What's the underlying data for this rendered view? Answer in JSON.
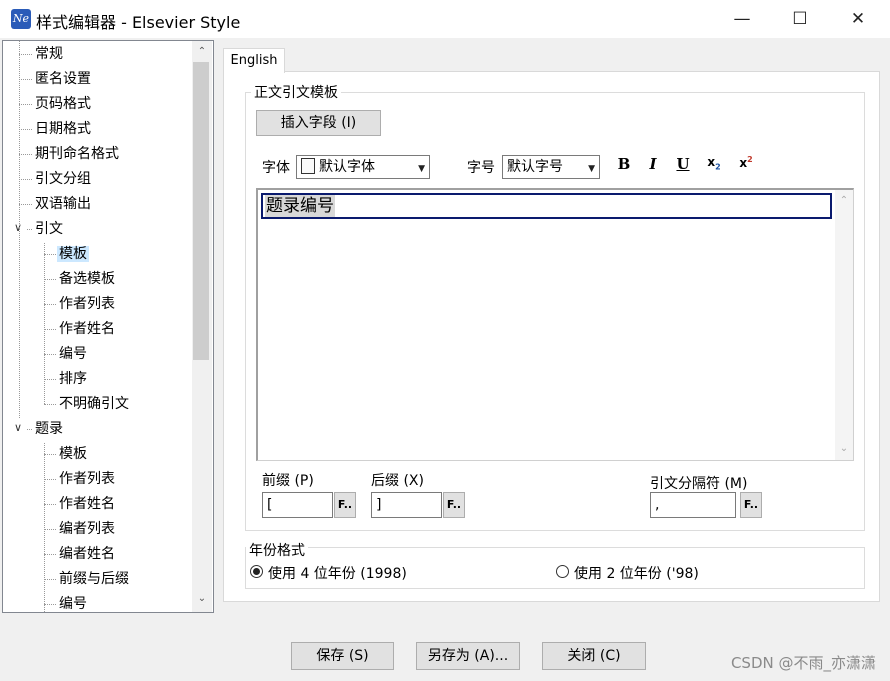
{
  "window": {
    "title": "样式编辑器 - Elsevier Style",
    "icon_text": "Ne",
    "minimize_icon": "minimize-icon",
    "maximize_icon": "maximize-icon",
    "close_icon": "close-icon"
  },
  "tree": {
    "items": [
      {
        "label": "常规"
      },
      {
        "label": "匿名设置"
      },
      {
        "label": "页码格式"
      },
      {
        "label": "日期格式"
      },
      {
        "label": "期刊命名格式"
      },
      {
        "label": "引文分组"
      },
      {
        "label": "双语输出"
      },
      {
        "label": "引文"
      },
      {
        "label": "模板"
      },
      {
        "label": "备选模板"
      },
      {
        "label": "作者列表"
      },
      {
        "label": "作者姓名"
      },
      {
        "label": "编号"
      },
      {
        "label": "排序"
      },
      {
        "label": "不明确引文"
      },
      {
        "label": "题录"
      },
      {
        "label": "模板"
      },
      {
        "label": "作者列表"
      },
      {
        "label": "作者姓名"
      },
      {
        "label": "编者列表"
      },
      {
        "label": "编者姓名"
      },
      {
        "label": "前缀与后缀"
      },
      {
        "label": "编号"
      }
    ],
    "selected": "模板"
  },
  "tab": {
    "label": "English"
  },
  "body_template": {
    "group_title": "正文引文模板",
    "insert_field_label": "插入字段",
    "insert_field_key": "(I)",
    "font_label": "字体",
    "font_value": "默认字体",
    "size_label": "字号",
    "size_value": "默认字号",
    "bold": "B",
    "italic": "I",
    "underline": "U",
    "subscript": "x",
    "subscript_mark": "2",
    "superscript": "x",
    "superscript_mark": "2",
    "editor_field": "题录编号",
    "prefix_label": "前缀",
    "prefix_key": "(P)",
    "prefix_value": "[",
    "suffix_label": "后缀",
    "suffix_key": "(X)",
    "suffix_value": "]",
    "separator_label": "引文分隔符",
    "separator_key": "(M)",
    "separator_value": ",",
    "f_button": "F.."
  },
  "year_format": {
    "group_title": "年份格式",
    "option_4": "使用 4 位年份 (1998)",
    "option_2": "使用 2 位年份 ('98)",
    "selected": "option_4"
  },
  "footer": {
    "save": "保存",
    "save_key": "(S)",
    "save_as": "另存为",
    "save_as_key": "(A)...",
    "close": "关闭",
    "close_key": "(C)"
  },
  "watermark": "CSDN @不雨_亦潇潇"
}
